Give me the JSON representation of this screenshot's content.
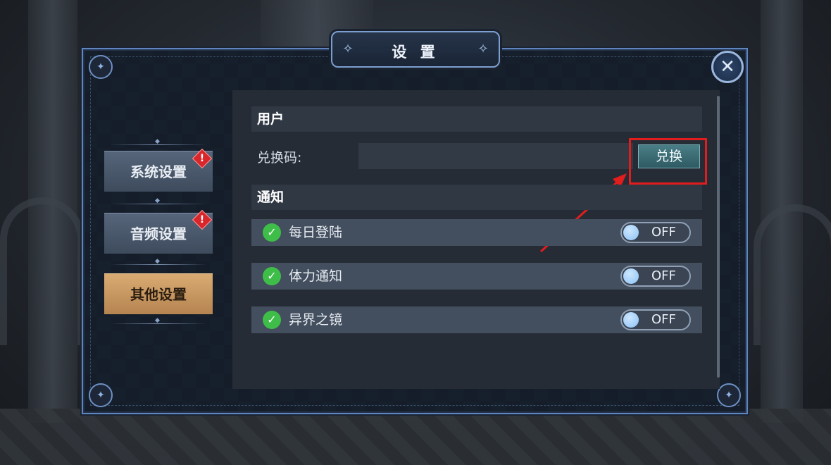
{
  "panel": {
    "title": "设 置",
    "close_icon": "close-icon"
  },
  "menu": {
    "items": [
      {
        "label": "系统设置",
        "badge": "!",
        "active": false
      },
      {
        "label": "音频设置",
        "badge": "!",
        "active": false
      },
      {
        "label": "其他设置",
        "badge": "",
        "active": true
      }
    ]
  },
  "user_section": {
    "header": "用户",
    "redeem_label": "兑换码:",
    "redeem_value": "",
    "redeem_button": "兑换"
  },
  "notify_section": {
    "header": "通知",
    "items": [
      {
        "label": "每日登陆",
        "state": "OFF"
      },
      {
        "label": "体力通知",
        "state": "OFF"
      },
      {
        "label": "异界之镜",
        "state": "OFF"
      }
    ]
  },
  "colors": {
    "active_tab": "#d9ab72",
    "badge": "#d8262b",
    "check": "#3fbd49",
    "annotation": "#e11d1d"
  }
}
